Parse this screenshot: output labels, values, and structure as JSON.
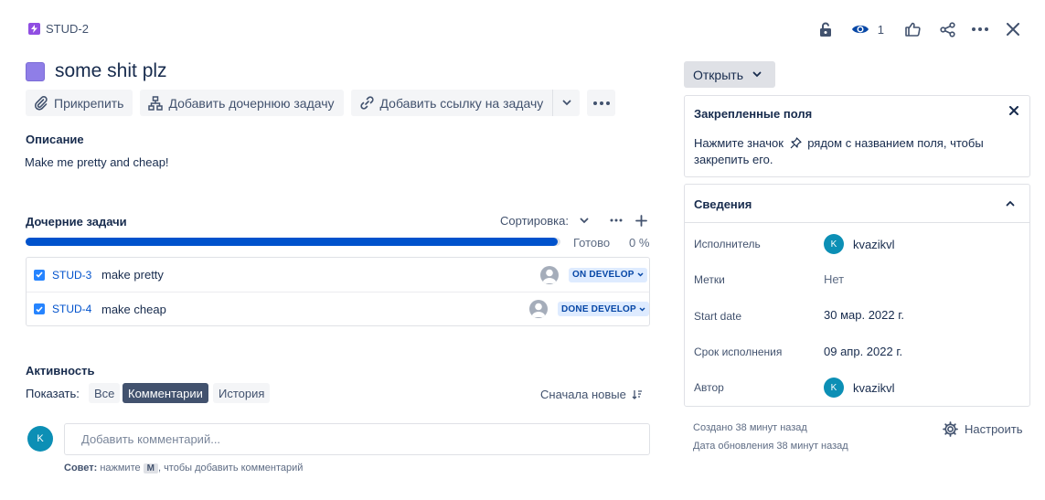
{
  "header": {
    "issue_key": "STUD-2",
    "watch_count": "1",
    "icons": [
      "lock-icon",
      "eye-icon",
      "thumbs-up-icon",
      "share-icon",
      "more-icon",
      "close-icon"
    ]
  },
  "issue": {
    "title": "some shit plz",
    "type_color": "#8f7ee7"
  },
  "actions": {
    "attach": "Прикрепить",
    "add_child": "Добавить дочернюю задачу",
    "add_link": "Добавить ссылку на задачу"
  },
  "description": {
    "label": "Описание",
    "text": "Make me pretty and cheap!"
  },
  "child_tasks": {
    "label": "Дочерние задачи",
    "sort_label": "Сортировка:",
    "progress_label": "Готово",
    "progress_pct": "0 %",
    "progress_value": 0.995,
    "items": [
      {
        "key": "STUD-3",
        "summary": "make pretty",
        "status": "ON DEVELOP"
      },
      {
        "key": "STUD-4",
        "summary": "make cheap",
        "status": "DONE DEVELOP"
      }
    ]
  },
  "activity": {
    "label": "Активность",
    "show_label": "Показать:",
    "filters": {
      "all": "Все",
      "comments": "Комментарии",
      "history": "История"
    },
    "order": "Сначала новые",
    "avatar_initial": "K",
    "comment_placeholder": "Добавить комментарий...",
    "tip_bold": "Совет:",
    "tip_pre": "нажмите",
    "tip_key": "M",
    "tip_post": ", чтобы добавить комментарий"
  },
  "sidebar": {
    "status": "Открыть",
    "pinned": {
      "title": "Закрепленные поля",
      "text_pre": "Нажмите значок",
      "text_post": "рядом с названием поля, чтобы закрепить его."
    },
    "details": {
      "title": "Сведения",
      "fields": {
        "assignee_label": "Исполнитель",
        "assignee_value": "kvazikvl",
        "assignee_initial": "K",
        "labels_label": "Метки",
        "labels_value": "Нет",
        "start_label": "Start date",
        "start_value": "30 мар. 2022 г.",
        "due_label": "Срок исполнения",
        "due_value": "09 апр. 2022 г.",
        "author_label": "Автор",
        "author_value": "kvazikvl",
        "author_initial": "K"
      }
    },
    "created": "Создано 38 минут назад",
    "updated": "Дата обновления 38 минут назад",
    "configure": "Настроить"
  },
  "colors": {
    "primary": "#0052cc",
    "status_bg": "#deebff",
    "avatar": "#0c8fb5"
  }
}
